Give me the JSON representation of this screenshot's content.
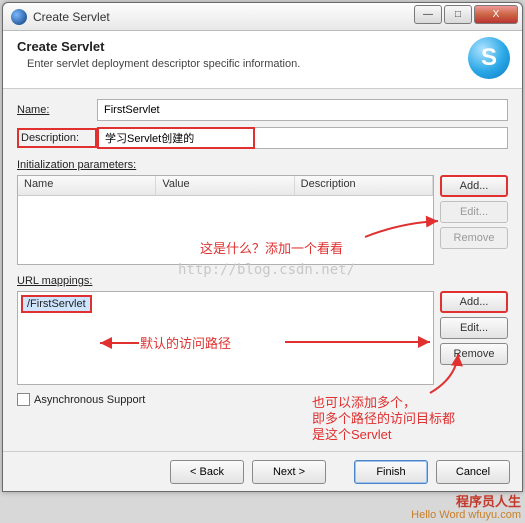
{
  "window": {
    "title": "Create Servlet"
  },
  "winbtns": {
    "min": "—",
    "max": "□",
    "close": "X"
  },
  "header": {
    "title": "Create Servlet",
    "subtitle": "Enter servlet deployment descriptor specific information.",
    "icon_letter": "S"
  },
  "form": {
    "name_label": "Name:",
    "name_value": "FirstServlet",
    "desc_label": "Description:",
    "desc_value": "学习Servlet创建的"
  },
  "init_params": {
    "section_label": "Initialization parameters:",
    "cols": {
      "name": "Name",
      "value": "Value",
      "desc": "Description"
    },
    "buttons": {
      "add": "Add...",
      "edit": "Edit...",
      "remove": "Remove"
    }
  },
  "url_mappings": {
    "section_label": "URL mappings:",
    "items": [
      "/FirstServlet"
    ],
    "buttons": {
      "add": "Add...",
      "edit": "Edit...",
      "remove": "Remove"
    }
  },
  "async": {
    "label": "Asynchronous Support"
  },
  "footer": {
    "back": "< Back",
    "next": "Next >",
    "finish": "Finish",
    "cancel": "Cancel"
  },
  "annotations": {
    "a1": "这是什么？添加一个看看",
    "a2": "默认的访问路径",
    "a3_l1": "也可以添加多个，",
    "a3_l2": "即多个路径的访问目标都",
    "a3_l3": "是这个Servlet"
  },
  "watermark": "http://blog.csdn.net/",
  "brand": {
    "l1": "程序员人生",
    "l2": "Hello Word    wfuyu.com"
  }
}
